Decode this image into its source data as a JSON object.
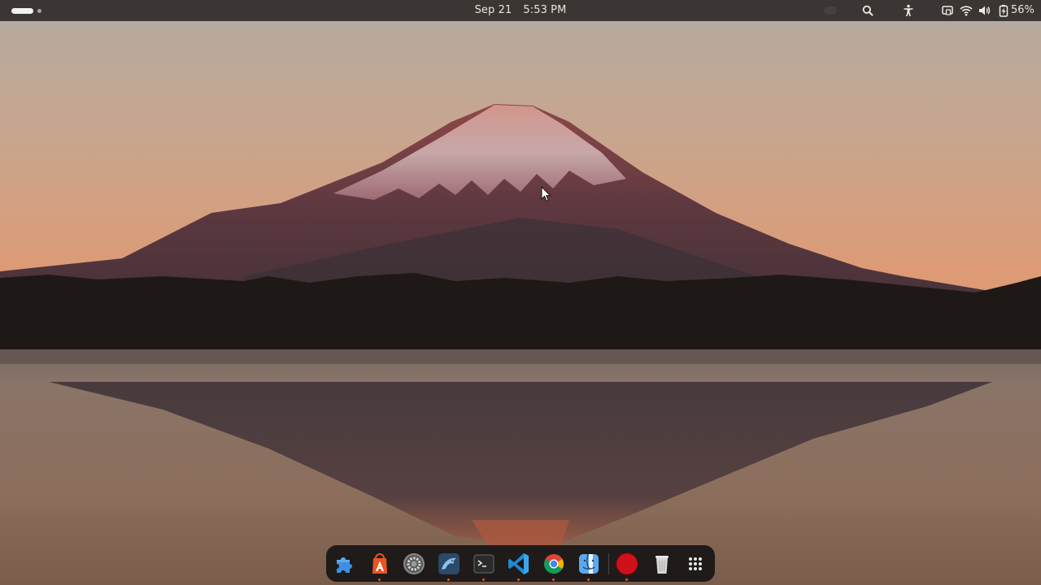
{
  "topbar": {
    "date": "Sep 21",
    "time": "5:53 PM",
    "battery_percent": "56%",
    "workspaces": {
      "count": 2,
      "active": 1
    }
  },
  "tray_icons": [
    "search-icon",
    "accessibility-icon",
    "screen-share-icon",
    "wifi-icon",
    "volume-icon",
    "battery-icon"
  ],
  "dock": {
    "items": [
      {
        "name": "extensions",
        "icon": "puzzle-icon",
        "running": false
      },
      {
        "name": "software-center",
        "icon": "app-store-icon",
        "running": true
      },
      {
        "name": "system-settings",
        "icon": "settings-gear-icon",
        "running": false
      },
      {
        "name": "mysql-workbench",
        "icon": "dolphin-icon",
        "running": true
      },
      {
        "name": "terminal",
        "icon": "terminal-icon",
        "running": true
      },
      {
        "name": "vscode",
        "icon": "vscode-icon",
        "running": true
      },
      {
        "name": "chrome",
        "icon": "chrome-icon",
        "running": true
      },
      {
        "name": "finder",
        "icon": "finder-icon",
        "running": true
      },
      {
        "name": "screen-recorder",
        "icon": "record-icon",
        "running": true
      },
      {
        "name": "trash",
        "icon": "trash-icon",
        "running": false
      },
      {
        "name": "show-apps",
        "icon": "app-grid-icon",
        "running": false
      }
    ]
  },
  "colors": {
    "topbar_bg": "#3b3633",
    "dock_bg": "#181616",
    "accent_running": "#e95420",
    "sky_top": "#b8aca2",
    "sky_horizon": "#e49a72"
  }
}
